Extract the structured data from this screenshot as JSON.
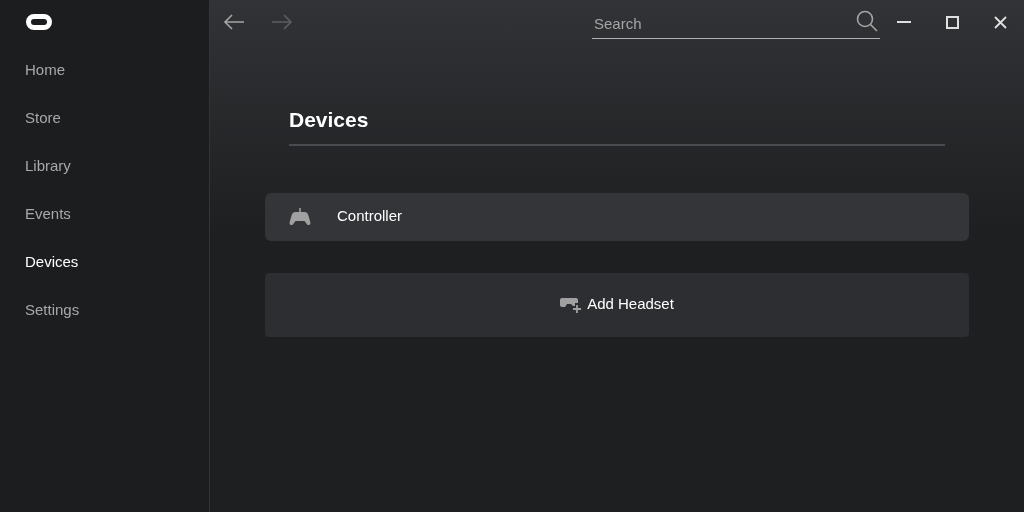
{
  "sidebar": {
    "items": [
      {
        "label": "Home",
        "selected": false
      },
      {
        "label": "Store",
        "selected": false
      },
      {
        "label": "Library",
        "selected": false
      },
      {
        "label": "Events",
        "selected": false
      },
      {
        "label": "Devices",
        "selected": true
      },
      {
        "label": "Settings",
        "selected": false
      }
    ]
  },
  "toolbar": {
    "back": {
      "disabled": false
    },
    "forward": {
      "disabled": true
    },
    "search": {
      "placeholder": "Search"
    }
  },
  "page": {
    "title": "Devices",
    "devices": [
      {
        "name": "Controller"
      }
    ],
    "add_button": {
      "label": "Add Headset"
    }
  }
}
